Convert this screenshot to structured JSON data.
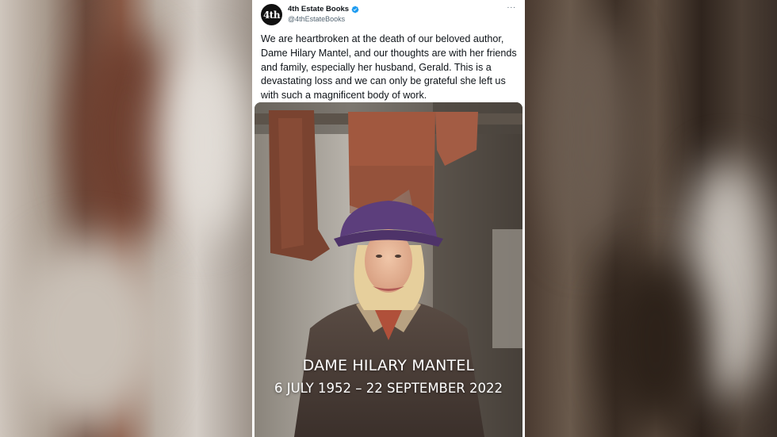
{
  "tweet": {
    "account_name": "4th Estate Books",
    "account_handle": "@4thEstateBooks",
    "avatar_text": "4th",
    "verified_icon": "verified-badge-icon",
    "more_icon": "more-options-icon",
    "more_label": "···",
    "text": "We are heartbroken at the death of our beloved author, Dame Hilary Mantel, and our thoughts are with her friends and family, especially her husband, Gerald. This is a devastating loss and we can only be grateful she left us with such a magnificent body of work."
  },
  "photo": {
    "caption_name": "DAME HILARY MANTEL",
    "caption_dates": "6 JULY 1952 – 22 SEPTEMBER 2022"
  },
  "colors": {
    "verified_blue": "#1d9bf0",
    "text_primary": "#0f1419",
    "text_secondary": "#536471"
  }
}
